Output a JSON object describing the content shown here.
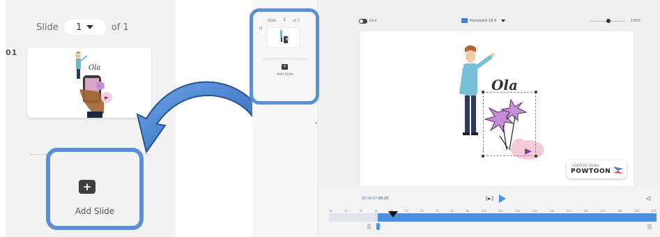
{
  "zoomed_panel": {
    "slide_label": "Slide",
    "slide_value": "1",
    "of_label": "of 1",
    "slide_number": "01",
    "add_slide_label": "Add Slide"
  },
  "editor": {
    "sidebar": {
      "slide_label": "Slide",
      "slide_value": "1",
      "of_label": "of 1",
      "slide_number": "01",
      "add_slide_label": "Add Slide"
    },
    "toolbar": {
      "grid_label": "Grid",
      "layout_label": "Horizontal 16:9",
      "zoom_label": "100%"
    },
    "canvas": {
      "text_art": "Ola",
      "watermark_top": "CREATED USING",
      "watermark_brand": "POWTOON"
    },
    "timeline": {
      "current_time": "00:04.07",
      "total_time": "00:20",
      "play_label": "[►]",
      "ruler_ticks": [
        "0s",
        "1s",
        "2s",
        "3s",
        "4s",
        "5s",
        "6s",
        "7s",
        "8s",
        "9s",
        "10s",
        "11s",
        "12s",
        "13s",
        "14s",
        "15s",
        "16s",
        "17s",
        "18s",
        "19s",
        "20s"
      ]
    }
  },
  "colors": {
    "highlight": "#5b8fd0",
    "accent_blue": "#4a8fe0",
    "panel_bg": "#f2f2f2"
  }
}
